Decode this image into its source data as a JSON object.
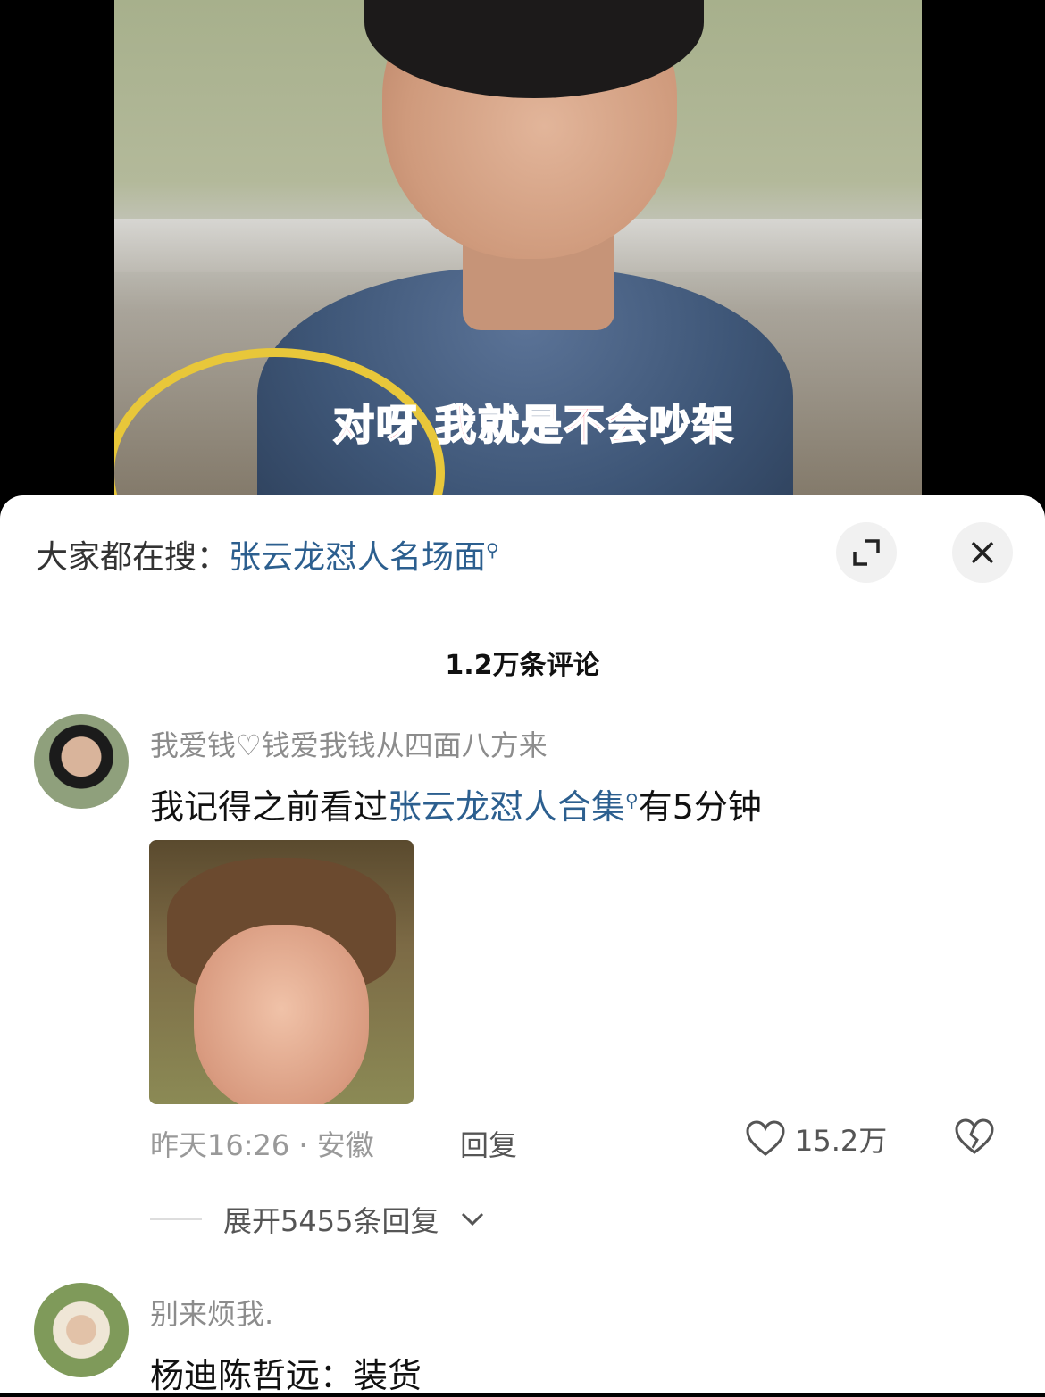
{
  "video": {
    "subtitle": "对呀 我就是不会吵架"
  },
  "search": {
    "prefix": "大家都在搜：",
    "keyword": "张云龙怼人名场面"
  },
  "comments_count": "1.2万条评论",
  "comments": [
    {
      "username": "我爱钱♡钱爱我钱从四面八方来",
      "text_before": "我记得之前看过",
      "text_keyword": "张云龙怼人合集",
      "text_after": "有5分钟",
      "time_location": "昨天16:26 · 安徽",
      "reply_label": "回复",
      "likes": "15.2万",
      "expand_replies": "展开5455条回复"
    },
    {
      "username": "别来烦我.",
      "text": "杨迪陈哲远：装货"
    }
  ],
  "icons": {
    "search": "magnifier-icon",
    "expand": "expand-icon",
    "close": "close-icon",
    "like": "heart-icon",
    "dislike": "broken-heart-icon",
    "chevron": "chevron-down-icon"
  },
  "colors": {
    "keyword": "#2c5f8f",
    "subtitle": "#f03e5c"
  }
}
